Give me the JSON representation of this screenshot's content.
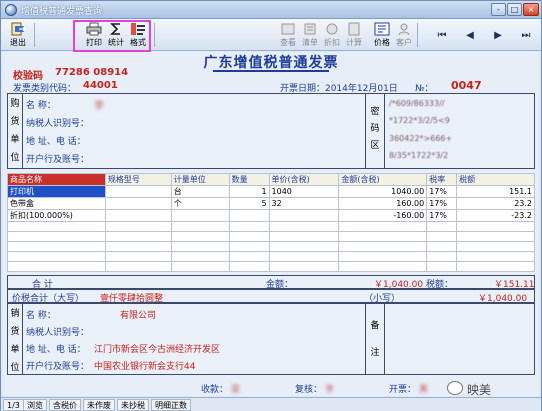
{
  "window": {
    "title": "增值税普通发票查询",
    "controls": [
      "-",
      "□",
      "×"
    ]
  },
  "toolbar": {
    "buttons": [
      {
        "label": "退出",
        "icon": "exit-icon"
      },
      {
        "label": "打印",
        "icon": "printer-icon"
      },
      {
        "label": "统计",
        "icon": "sigma-icon"
      },
      {
        "label": "格式",
        "icon": "format-icon"
      },
      {
        "label": "查看",
        "icon": "view-icon"
      },
      {
        "label": "清单",
        "icon": "list-icon"
      },
      {
        "label": "折扣",
        "icon": "discount-icon"
      },
      {
        "label": "计算",
        "icon": "calc-icon"
      },
      {
        "label": "价格",
        "icon": "price-icon"
      },
      {
        "label": "客户",
        "icon": "customer-icon"
      }
    ],
    "nav": [
      "⏮",
      "◀",
      "▶",
      "⏭"
    ]
  },
  "invoice": {
    "title": "广东增值税普通发票",
    "check_code_label": "校验码",
    "check_code_value": "77286 08914",
    "type_code_label": "发票类别代码：",
    "type_code_value": "44001",
    "date_label": "开票日期：",
    "date_value": "2014年12月01日",
    "number_label": "№：",
    "number_value": "0047",
    "buyer": {
      "side_label": [
        "购",
        "货",
        "单",
        "位"
      ],
      "name_label": "名          称：",
      "name_value": "李",
      "taxid_label": "纳税人识别号：",
      "addr_label": "地 址、电 话：",
      "bank_label": "开户行及账号："
    },
    "cipher": {
      "side_label": [
        "密",
        "码",
        "区"
      ],
      "lines": [
        "/*609/86333//",
        "*1722*3/2/5<9",
        "360422*>666+",
        "8/35*1722*3/2"
      ]
    },
    "items": {
      "columns": [
        "商品名称",
        "规格型号",
        "计量单位",
        "数量",
        "单价(含税)",
        "金额(含税)",
        "税率",
        "税额"
      ],
      "rows": [
        [
          "打印机",
          "",
          "台",
          "1",
          "1040",
          "1040.00",
          "17%",
          "151.1"
        ],
        [
          "色带盒",
          "",
          "个",
          "5",
          "32",
          "160.00",
          "17%",
          "23.2"
        ],
        [
          "折扣(100.000%)",
          "",
          "",
          "",
          "",
          "-160.00",
          "17%",
          "-23.2"
        ]
      ]
    },
    "totals": {
      "heji_label": "合          计",
      "amount_label": "金额：",
      "amount_value": "￥1,040.00",
      "tax_label": "税额：",
      "tax_value": "￥151.11",
      "total_label": "价税合计（大写）",
      "total_daxie": "壹仟零肆拾圆整",
      "xiaoxie_label": "（小写）",
      "xiaoxie_value": "￥1,040.00"
    },
    "seller": {
      "side_label": [
        "销",
        "货",
        "单",
        "位"
      ],
      "name_label": "名          称：",
      "name_value": "有限公司",
      "taxid_label": "纳税人识别号：",
      "addr_label": "地 址、电 话：",
      "addr_value": "江门市新会区今古洲经济开发区",
      "bank_label": "开户行及账号：",
      "bank_value": "中国农业银行新会支行44",
      "remark_label": [
        "备",
        "注"
      ]
    },
    "footer": {
      "payee_label": "收款：",
      "payee_value": "梁",
      "reviewer_label": "复核：",
      "reviewer_value": "李",
      "drawer_label": "开票：",
      "drawer_value": "黄"
    }
  },
  "statusbar": [
    "1/3",
    "浏览",
    "含税价",
    "未作废",
    "未抄税",
    "明细正数"
  ],
  "watermark": "映美"
}
